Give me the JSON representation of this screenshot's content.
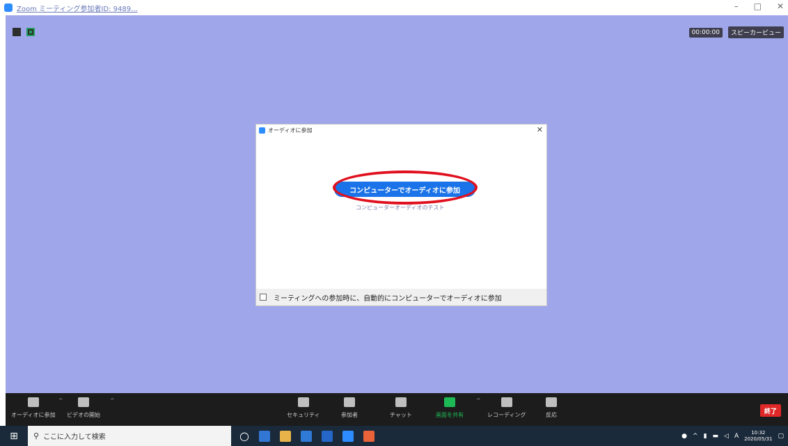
{
  "window": {
    "title": "Zoom ミーティング参加者ID: 9489..."
  },
  "meeting": {
    "timer": "00:00:00",
    "view_label": "スピーカービュー"
  },
  "dialog": {
    "title": "オーディオに参加",
    "join_button": "コンピューターでオーディオに参加",
    "test_link": "コンピューターオーディオのテスト",
    "auto_join_label": "ミーティングへの参加時に、自動的にコンピューターでオーディオに参加",
    "auto_join_checked": false
  },
  "toolbar": {
    "items": [
      {
        "label": "オーディオに参加",
        "icon": "headphones-icon"
      },
      {
        "label": "ビデオの開始",
        "icon": "video-camera-icon"
      },
      {
        "label": "セキュリティ",
        "icon": "shield-icon"
      },
      {
        "label": "参加者",
        "icon": "participants-icon"
      },
      {
        "label": "チャット",
        "icon": "chat-icon"
      },
      {
        "label": "画面を共有",
        "icon": "share-screen-icon"
      },
      {
        "label": "レコーディング",
        "icon": "record-icon"
      },
      {
        "label": "反応",
        "icon": "reaction-icon"
      }
    ],
    "end_label": "終了",
    "share_color": "#1db954",
    "end_color": "#e02828"
  },
  "taskbar": {
    "search_placeholder": "ここに入力して検索",
    "time": "10:32",
    "date": "2020/05/31",
    "ime": "A"
  },
  "colors": {
    "meeting_bg": "#a0a6ea",
    "join_button": "#1a73e8",
    "highlight_ring": "#e0101e"
  }
}
